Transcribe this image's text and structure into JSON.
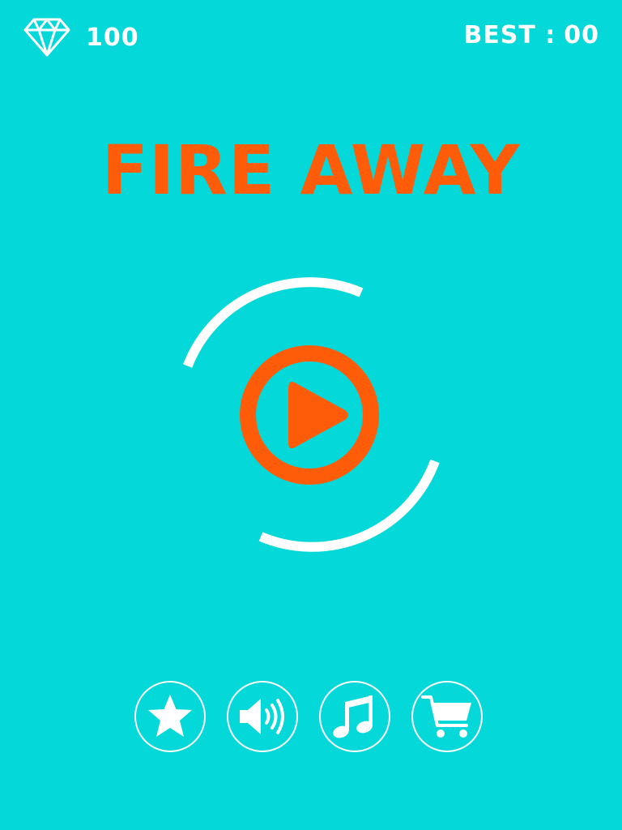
{
  "hud": {
    "gem_icon": "diamond-icon",
    "gem_count": "100",
    "best_label": "BEST :",
    "best_value": "00"
  },
  "title": "FIRE AWAY",
  "play_button": {
    "icon": "play-icon",
    "ring_icon": "rotating-ring"
  },
  "bottom_buttons": [
    {
      "id": "rate",
      "icon": "star-icon"
    },
    {
      "id": "sound",
      "icon": "speaker-icon"
    },
    {
      "id": "music",
      "icon": "music-note-icon"
    },
    {
      "id": "shop",
      "icon": "shopping-cart-icon"
    }
  ],
  "colors": {
    "background": "#04d8d8",
    "accent": "#ff5c0a",
    "foreground": "#ffffff"
  }
}
